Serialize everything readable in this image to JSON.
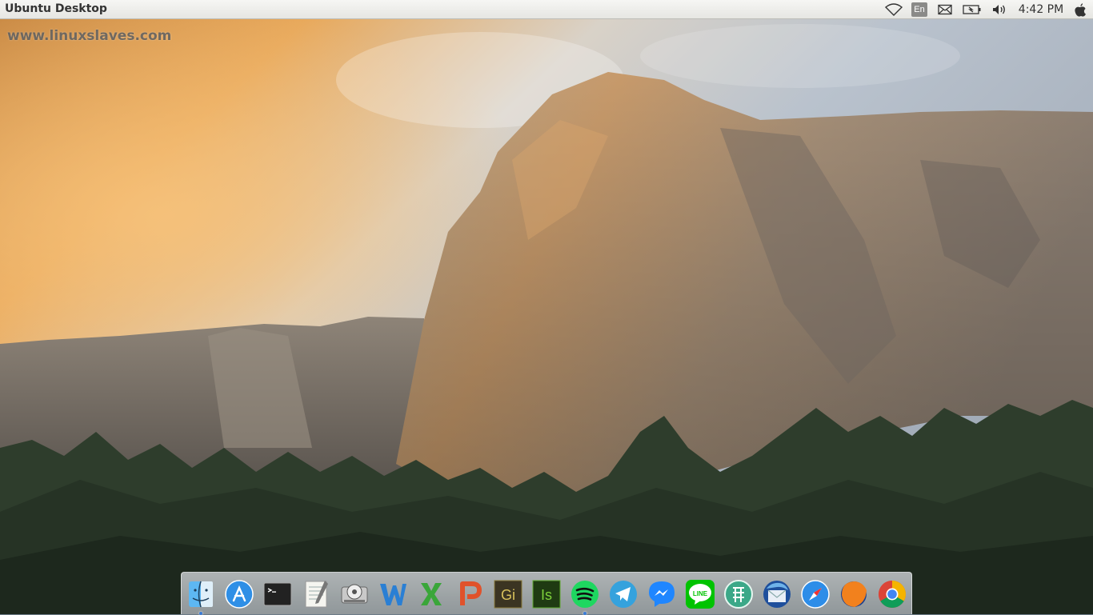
{
  "panel": {
    "title": "Ubuntu Desktop",
    "language": "En",
    "clock": "4:42 PM"
  },
  "watermark": "www.linuxslaves.com",
  "wallpaper": {
    "subject": "El Capitan cliff, Yosemite"
  },
  "dock": {
    "items": [
      {
        "name": "Finder",
        "icon": "finder-icon",
        "running": true
      },
      {
        "name": "App Store",
        "icon": "app-store-icon",
        "running": false
      },
      {
        "name": "Terminal",
        "icon": "terminal-icon",
        "running": false
      },
      {
        "name": "Text Editor",
        "icon": "notepad-icon",
        "running": false
      },
      {
        "name": "Disk Utility",
        "icon": "disk-utility-icon",
        "running": false
      },
      {
        "name": "WPS Writer",
        "icon": "wps-writer-icon",
        "running": false
      },
      {
        "name": "WPS Spreadsheets",
        "icon": "wps-spreadsheets-icon",
        "running": false
      },
      {
        "name": "WPS Presentation",
        "icon": "wps-presentation-icon",
        "running": false
      },
      {
        "name": "GIMP",
        "icon": "gimp-icon",
        "running": false
      },
      {
        "name": "Inkscape",
        "icon": "inkscape-icon",
        "running": false
      },
      {
        "name": "Spotify",
        "icon": "spotify-icon",
        "running": true
      },
      {
        "name": "Telegram",
        "icon": "telegram-icon",
        "running": false
      },
      {
        "name": "Messenger",
        "icon": "messenger-icon",
        "running": false
      },
      {
        "name": "LINE",
        "icon": "line-icon",
        "running": false
      },
      {
        "name": "Franz",
        "icon": "franz-icon",
        "running": false
      },
      {
        "name": "Thunderbird",
        "icon": "thunderbird-icon",
        "running": false
      },
      {
        "name": "Safari",
        "icon": "safari-icon",
        "running": false
      },
      {
        "name": "Firefox",
        "icon": "firefox-icon",
        "running": false
      },
      {
        "name": "Chrome",
        "icon": "chrome-icon",
        "running": false
      }
    ]
  }
}
